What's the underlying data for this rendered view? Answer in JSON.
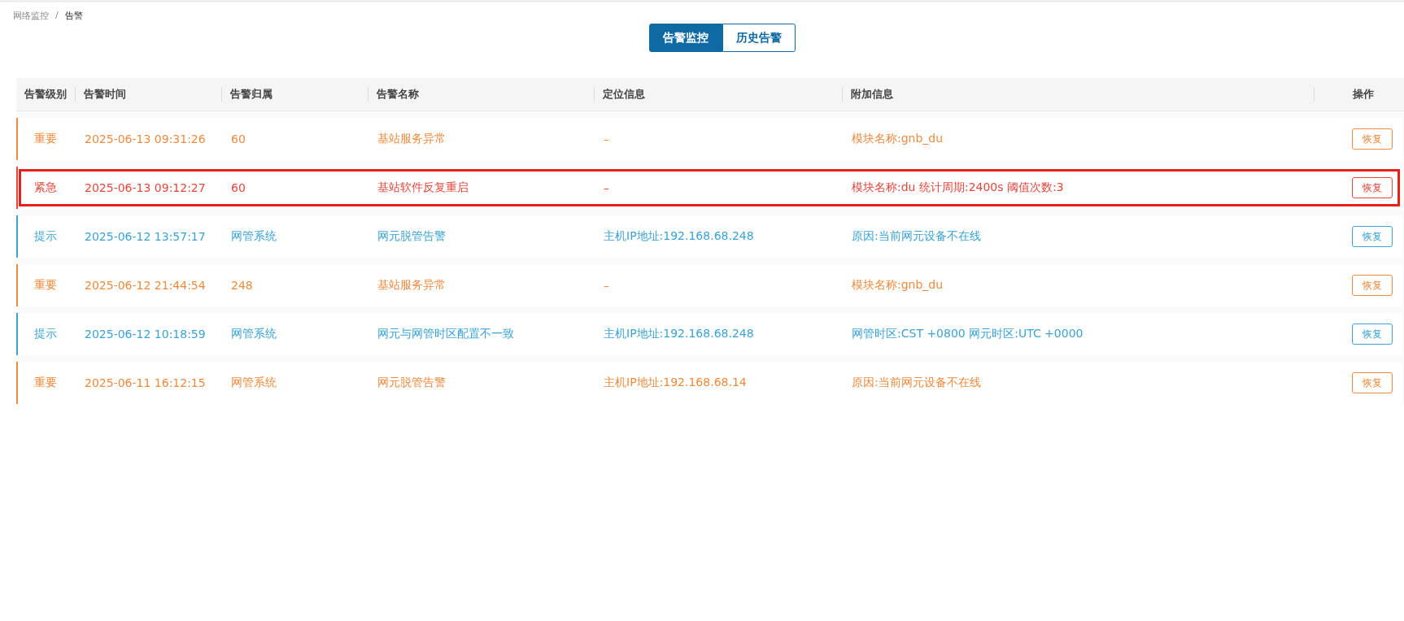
{
  "breadcrumb": [
    "网络监控",
    "告警"
  ],
  "breadcrumb_separator": "/",
  "view_tabs": [
    {
      "label": "告警监控",
      "selected": true
    },
    {
      "label": "历史告警",
      "selected": false
    }
  ],
  "table": {
    "columns": [
      "告警级别",
      "告警时间",
      "告警归属",
      "告警名称",
      "定位信息",
      "附加信息",
      "操作"
    ],
    "rows": [
      {
        "kind": "major",
        "highlighted": false,
        "level": "重要",
        "time": "2025-06-13 09:31:26",
        "owner": "60",
        "name": "基站服务异常",
        "location": "–",
        "extra": "模块名称:gnb_du",
        "action": "恢复"
      },
      {
        "kind": "critical",
        "highlighted": true,
        "level": "紧急",
        "time": "2025-06-13 09:12:27",
        "owner": "60",
        "name": "基站软件反复重启",
        "location": "–",
        "extra": "模块名称:du 统计周期:2400s 阈值次数:3",
        "action": "恢复"
      },
      {
        "kind": "info",
        "highlighted": false,
        "level": "提示",
        "time": "2025-06-12 13:57:17",
        "owner": "网管系统",
        "name": "网元脱管告警",
        "location": "主机IP地址:192.168.68.248",
        "extra": "原因:当前网元设备不在线",
        "action": "恢复"
      },
      {
        "kind": "major",
        "highlighted": false,
        "level": "重要",
        "time": "2025-06-12 21:44:54",
        "owner": "248",
        "name": "基站服务异常",
        "location": "–",
        "extra": "模块名称:gnb_du",
        "action": "恢复"
      },
      {
        "kind": "info",
        "highlighted": false,
        "level": "提示",
        "time": "2025-06-12 10:18:59",
        "owner": "网管系统",
        "name": "网元与网管时区配置不一致",
        "location": "主机IP地址:192.168.68.248",
        "extra": "网管时区:CST +0800 网元时区:UTC +0000",
        "action": "恢复"
      },
      {
        "kind": "major",
        "highlighted": false,
        "level": "重要",
        "time": "2025-06-11 16:12:15",
        "owner": "网管系统",
        "name": "网元脱管告警",
        "location": "主机IP地址:192.168.68.14",
        "extra": "原因:当前网元设备不在线",
        "action": "恢复"
      }
    ]
  }
}
